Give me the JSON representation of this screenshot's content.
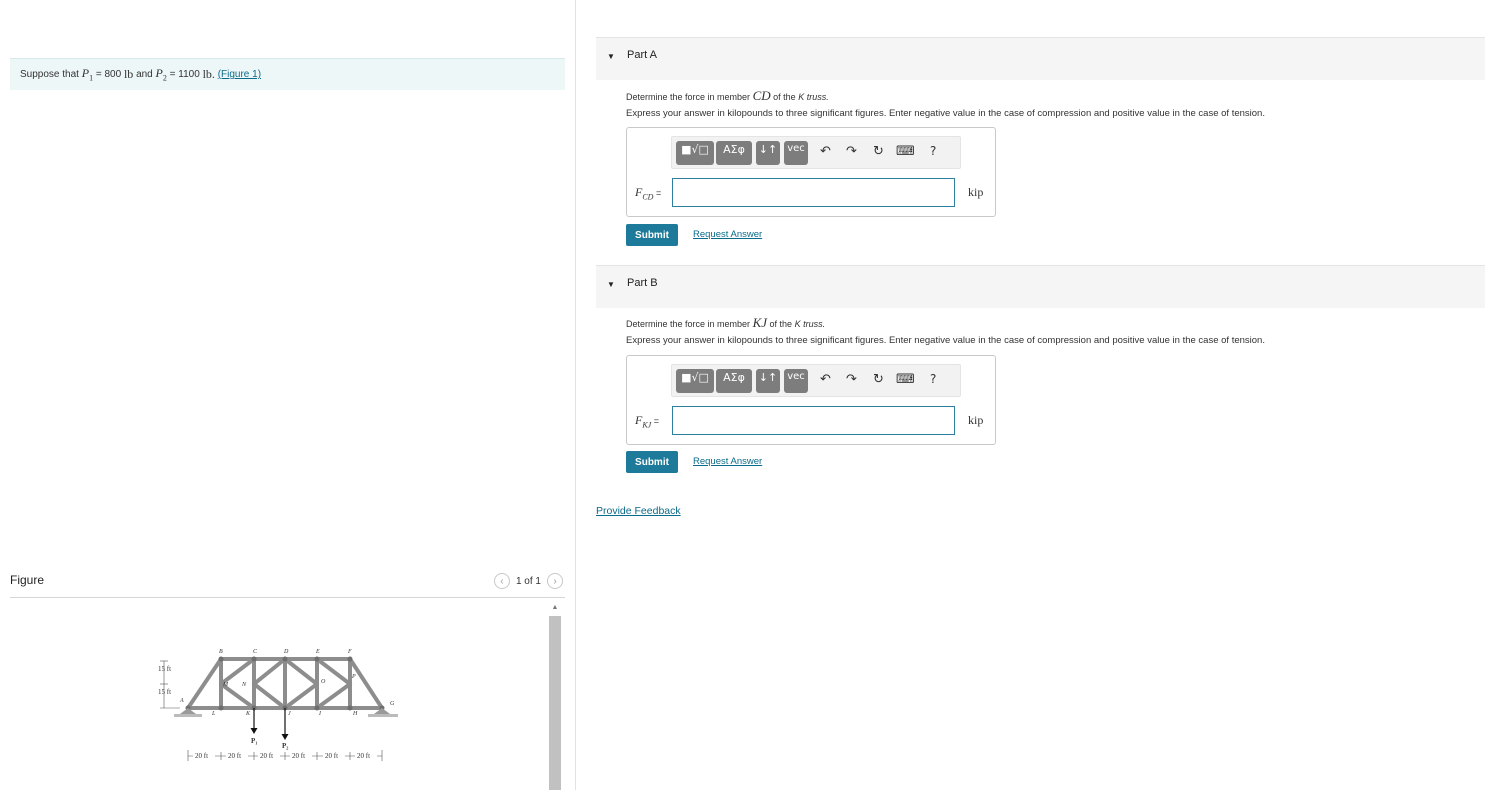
{
  "intro": {
    "prefix": "Suppose that",
    "p1_symbol": "P",
    "p1_sub": "1",
    "p1_eq": "= 800",
    "p1_unit": "lb",
    "and": "and",
    "p2_symbol": "P",
    "p2_sub": "2",
    "p2_eq": "= 1100",
    "p2_unit": "lb.",
    "figure_link": "(Figure 1)"
  },
  "figure": {
    "title": "Figure",
    "pager": "1 of 1",
    "prev_icon": "chevron-left-icon",
    "next_icon": "chevron-right-icon",
    "truss": {
      "top_joints": [
        "B",
        "C",
        "D",
        "E",
        "F"
      ],
      "bottom_joints": [
        "A",
        "L",
        "K",
        "J",
        "I",
        "H",
        "G"
      ],
      "mid_joints": [
        "M",
        "N",
        "O",
        "P"
      ],
      "heights": [
        "15 ft",
        "15 ft"
      ],
      "spans": [
        "20 ft",
        "20 ft",
        "20 ft",
        "20 ft",
        "20 ft",
        "20 ft"
      ],
      "loads": [
        "P₁",
        "P₂"
      ]
    }
  },
  "parts": [
    {
      "title": "Part A",
      "question_pre": "Determine the force in member",
      "member": "CD",
      "question_post": "of the",
      "truss_name": "K truss.",
      "express": "Express your answer in kilopounds to three significant figures. Enter negative value in the case of compression and positive value in the case of tension.",
      "var_symbol": "F",
      "var_sub": "CD",
      "eq": " =",
      "unit": "kip",
      "value": "",
      "submit": "Submit",
      "request": "Request Answer"
    },
    {
      "title": "Part B",
      "question_pre": "Determine the force in member",
      "member": "KJ",
      "question_post": "of the",
      "truss_name": "K truss.",
      "express": "Express your answer in kilopounds to three significant figures. Enter negative value in the case of compression and positive value in the case of tension.",
      "var_symbol": "F",
      "var_sub": "KJ",
      "eq": " =",
      "unit": "kip",
      "value": "",
      "submit": "Submit",
      "request": "Request Answer"
    }
  ],
  "toolbar": {
    "templates": "■√□",
    "greek": "ΑΣφ",
    "arrows": "↓↑",
    "vec": "vec",
    "undo": "↶",
    "redo": "↷",
    "reset": "↻",
    "keyboard": "⌨",
    "help": "?"
  },
  "feedback": "Provide Feedback"
}
